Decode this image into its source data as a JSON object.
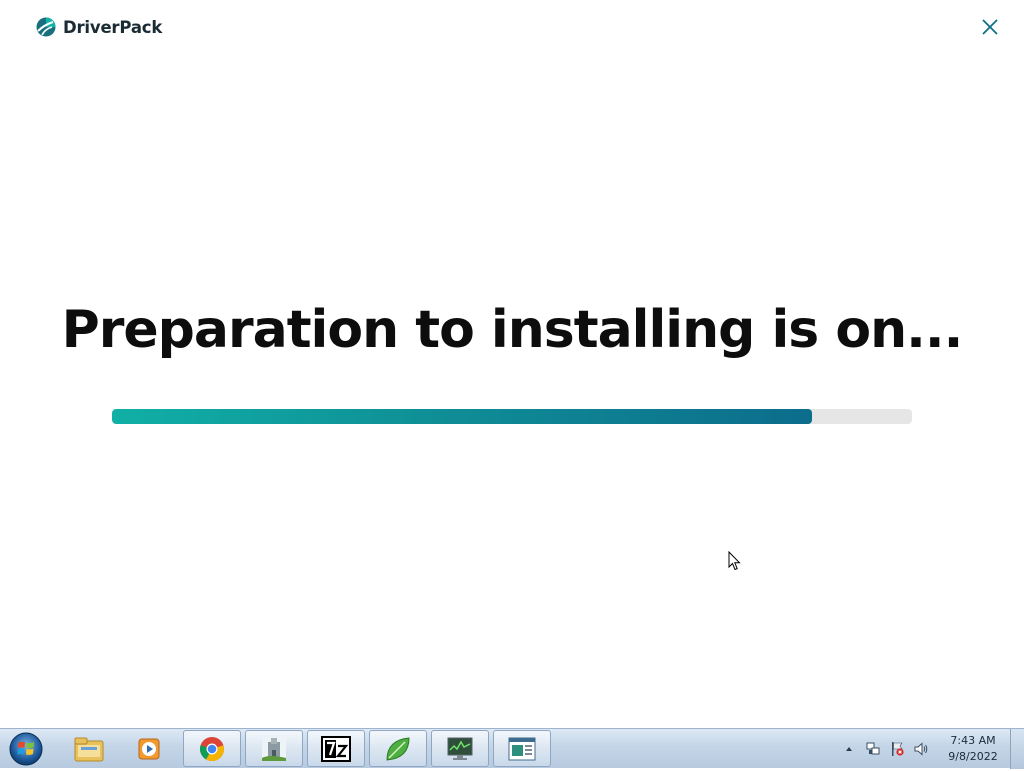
{
  "app": {
    "brand": "DriverPack",
    "heading": "Preparation to installing is on...",
    "progress_fraction": 0.875,
    "colors": {
      "accent_start": "#10b0a6",
      "accent_end": "#0c6d8c",
      "track": "#e6e6e6",
      "close": "#0d6f86"
    }
  },
  "taskbar": {
    "items": [
      {
        "name": "windows-explorer",
        "icon": "folder-icon"
      },
      {
        "name": "media-player",
        "icon": "media-player-icon"
      },
      {
        "name": "google-chrome",
        "icon": "chrome-icon"
      },
      {
        "name": "app-castle",
        "icon": "castle-icon"
      },
      {
        "name": "7-zip",
        "icon": "7zip-icon"
      },
      {
        "name": "leaf-app",
        "icon": "leaf-icon"
      },
      {
        "name": "task-monitor",
        "icon": "monitor-icon"
      },
      {
        "name": "app-window",
        "icon": "window-icon"
      }
    ],
    "clock_time": "7:43 AM",
    "clock_date": "9/8/2022"
  }
}
